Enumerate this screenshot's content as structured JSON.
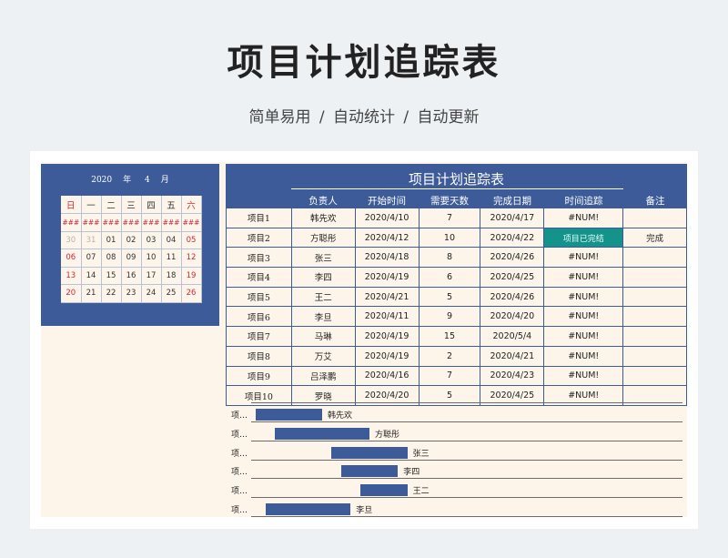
{
  "header": {
    "title": "项目计划追踪表",
    "subtitle": "简单易用  /  自动统计  /  自动更新"
  },
  "calendar": {
    "year": "2020",
    "year_unit": "年",
    "month": "4",
    "month_unit": "月",
    "weekdays": [
      "日",
      "一",
      "二",
      "三",
      "四",
      "五",
      "六"
    ],
    "rows": [
      [
        "###",
        "###",
        "###",
        "###",
        "###",
        "###",
        "###"
      ],
      [
        "30",
        "31",
        "01",
        "02",
        "03",
        "04",
        "05"
      ],
      [
        "06",
        "07",
        "08",
        "09",
        "10",
        "11",
        "12"
      ],
      [
        "13",
        "14",
        "15",
        "16",
        "17",
        "18",
        "19"
      ],
      [
        "20",
        "21",
        "22",
        "23",
        "24",
        "25",
        "26"
      ]
    ]
  },
  "tracker": {
    "title": "项目计划追踪表",
    "columns": [
      "负责人",
      "开始时间",
      "需要天数",
      "完成日期",
      "时间追踪",
      "备注"
    ],
    "rows": [
      {
        "project": "项目1",
        "owner": "韩先欢",
        "start": "2020/4/10",
        "days": "7",
        "end": "2020/4/17",
        "track": "#NUM!",
        "note": ""
      },
      {
        "project": "项目2",
        "owner": "方聪彤",
        "start": "2020/4/12",
        "days": "10",
        "end": "2020/4/22",
        "track": "项目已完结",
        "note": "完成"
      },
      {
        "project": "项目3",
        "owner": "张三",
        "start": "2020/4/18",
        "days": "8",
        "end": "2020/4/26",
        "track": "#NUM!",
        "note": ""
      },
      {
        "project": "项目4",
        "owner": "李四",
        "start": "2020/4/19",
        "days": "6",
        "end": "2020/4/25",
        "track": "#NUM!",
        "note": ""
      },
      {
        "project": "项目5",
        "owner": "王二",
        "start": "2020/4/21",
        "days": "5",
        "end": "2020/4/26",
        "track": "#NUM!",
        "note": ""
      },
      {
        "project": "项目6",
        "owner": "李旦",
        "start": "2020/4/11",
        "days": "9",
        "end": "2020/4/20",
        "track": "#NUM!",
        "note": ""
      },
      {
        "project": "项目7",
        "owner": "马琳",
        "start": "2020/4/19",
        "days": "15",
        "end": "2020/5/4",
        "track": "#NUM!",
        "note": ""
      },
      {
        "project": "项目8",
        "owner": "万艾",
        "start": "2020/4/19",
        "days": "2",
        "end": "2020/4/21",
        "track": "#NUM!",
        "note": ""
      },
      {
        "project": "项目9",
        "owner": "吕泽鹏",
        "start": "2020/4/16",
        "days": "7",
        "end": "2020/4/23",
        "track": "#NUM!",
        "note": ""
      },
      {
        "project": "项目10",
        "owner": "罗晓",
        "start": "2020/4/20",
        "days": "5",
        "end": "2020/4/25",
        "track": "#NUM!",
        "note": ""
      }
    ]
  },
  "gantt": {
    "row_label": "项…",
    "rows": [
      {
        "name": "韩先欢",
        "start": 0.5,
        "days": 7
      },
      {
        "name": "方聪彤",
        "start": 2.5,
        "days": 10
      },
      {
        "name": "张三",
        "start": 8.5,
        "days": 8
      },
      {
        "name": "李四",
        "start": 9.5,
        "days": 6
      },
      {
        "name": "王二",
        "start": 11.5,
        "days": 5
      },
      {
        "name": "李旦",
        "start": 1.5,
        "days": 9
      }
    ]
  },
  "colors": {
    "primary": "#3c5b98",
    "sheet": "#fdf5ea",
    "weekend": "#d0283a",
    "done": "#14938a"
  }
}
